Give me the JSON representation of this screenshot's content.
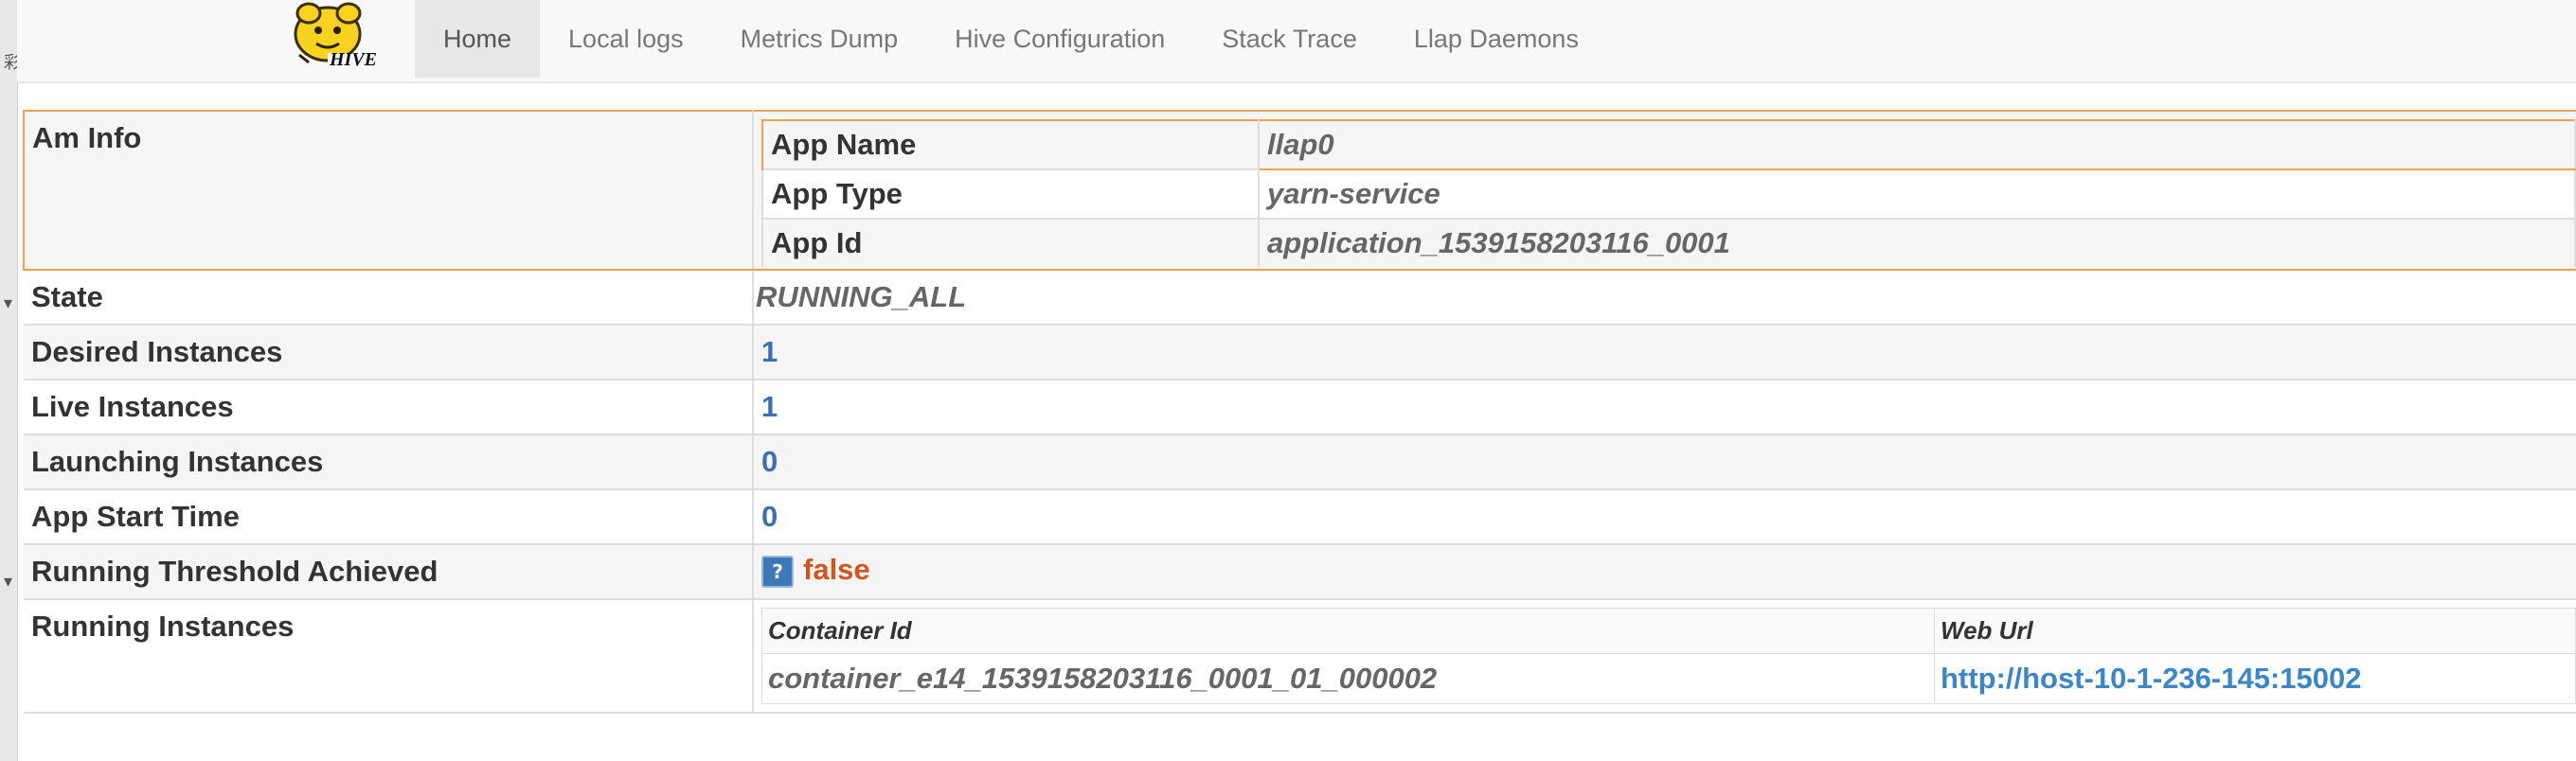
{
  "nav": {
    "logo_text": "HIVE",
    "items": [
      {
        "label": "Home"
      },
      {
        "label": "Local logs"
      },
      {
        "label": "Metrics Dump"
      },
      {
        "label": "Hive Configuration"
      },
      {
        "label": "Stack Trace"
      },
      {
        "label": "Llap Daemons"
      }
    ],
    "active_index": 0
  },
  "am_info": {
    "label": "Am Info",
    "rows": [
      {
        "label": "App Name",
        "value": "llap0"
      },
      {
        "label": "App Type",
        "value": "yarn-service"
      },
      {
        "label": "App Id",
        "value": "application_1539158203116_0001"
      }
    ]
  },
  "state": {
    "label": "State",
    "value": "RUNNING_ALL"
  },
  "desired_instances": {
    "label": "Desired Instances",
    "value": "1"
  },
  "live_instances": {
    "label": "Live Instances",
    "value": "1"
  },
  "launching_instances": {
    "label": "Launching Instances",
    "value": "0"
  },
  "app_start_time": {
    "label": "App Start Time",
    "value": "0"
  },
  "running_threshold": {
    "label": "Running Threshold Achieved",
    "value": "false",
    "help_icon": "question-icon"
  },
  "running_instances": {
    "label": "Running Instances",
    "headers": {
      "container_id": "Container Id",
      "web_url": "Web Url"
    },
    "rows": [
      {
        "container_id": "container_e14_1539158203116_0001_01_000002",
        "web_url": "http://host-10-1-236-145:15002"
      }
    ]
  },
  "colors": {
    "accent_border": "#f0a050",
    "link": "#3a86c8",
    "number": "#3a6fb5",
    "false": "#d2541e"
  }
}
